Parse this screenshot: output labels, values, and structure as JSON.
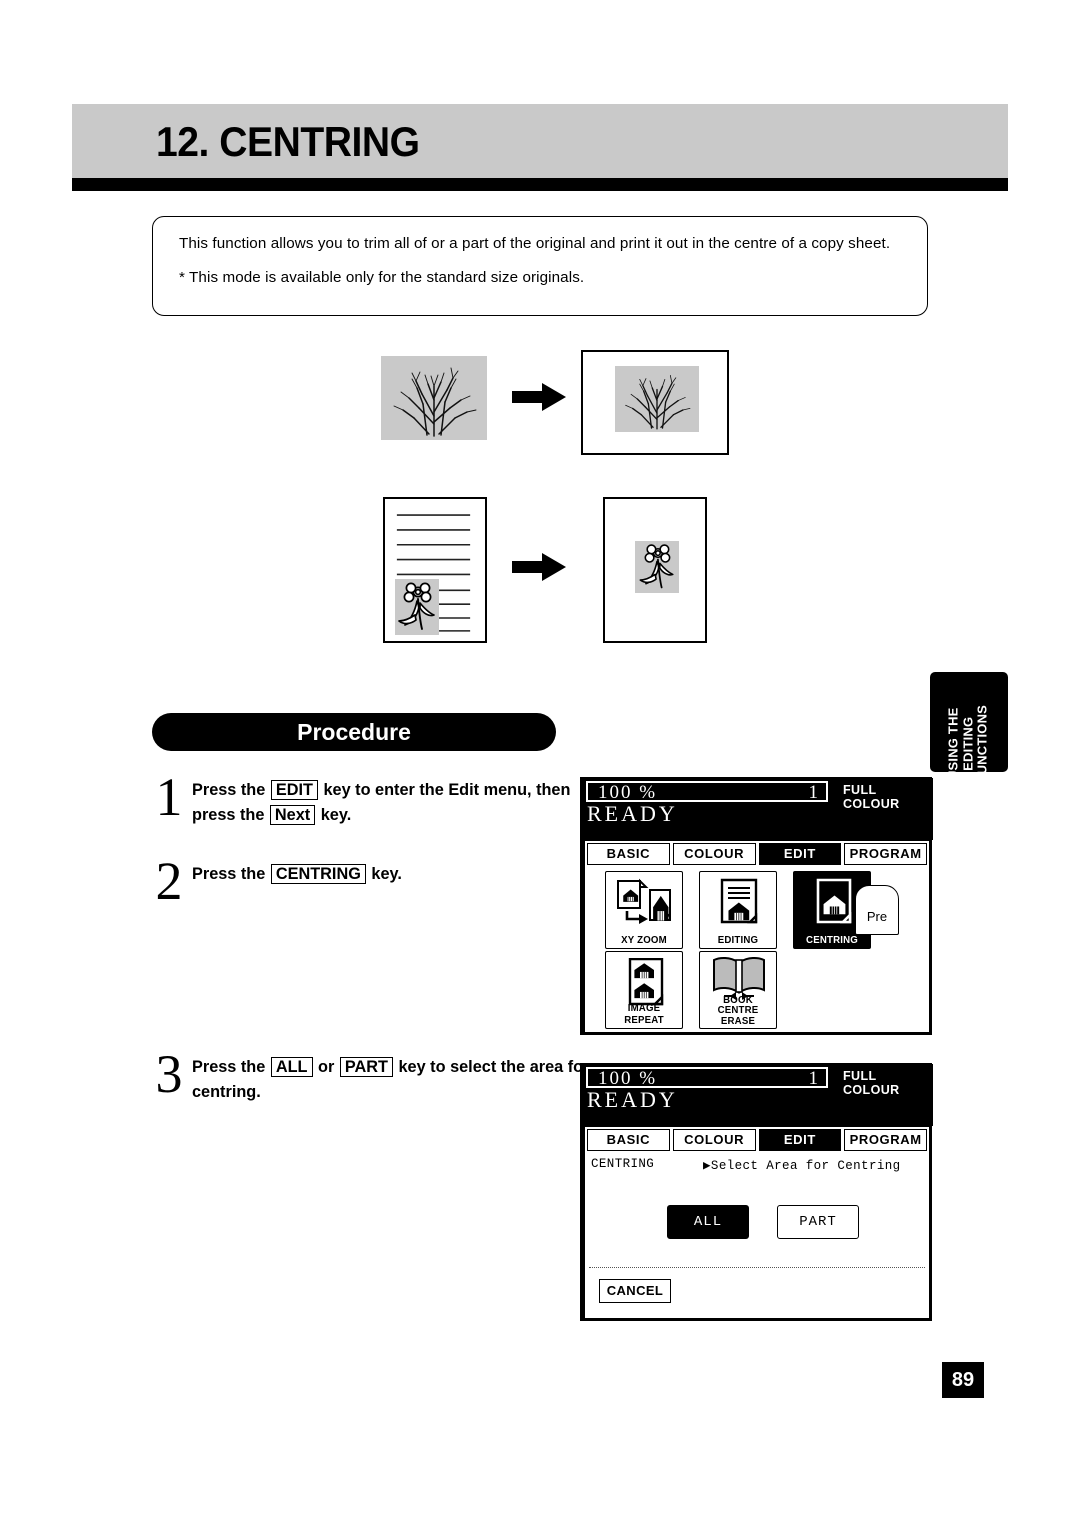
{
  "chapter": {
    "number_title": "12. CENTRING"
  },
  "intro": {
    "paragraph": "This function allows you to trim all of or a part of the original and print it out in the centre of a copy sheet.",
    "note": "* This mode is available only for the standard size originals."
  },
  "side_tab": {
    "label": "USING THE EDITING FUNCTIONS"
  },
  "procedure": {
    "heading": "Procedure",
    "steps": [
      {
        "number": "1",
        "text_parts": [
          "Press the ",
          "EDIT",
          " key to enter the Edit menu, then press the ",
          "Next",
          " key."
        ],
        "keys": [
          "EDIT",
          "Next"
        ]
      },
      {
        "number": "2",
        "text_parts": [
          "Press the ",
          "CENTRING",
          " key."
        ],
        "keys": [
          "CENTRING"
        ]
      },
      {
        "number": "3",
        "text_parts": [
          "Press the ",
          "ALL",
          " or ",
          "PART",
          " key to select the area for centring."
        ],
        "keys": [
          "ALL",
          "PART"
        ]
      }
    ]
  },
  "lcd_panel_1": {
    "status": {
      "zoom": "100 %",
      "copy_count": "1",
      "colour_mode": "FULL COLOUR",
      "message": "READY"
    },
    "tabs": [
      {
        "label": "BASIC",
        "active": false
      },
      {
        "label": "COLOUR",
        "active": false
      },
      {
        "label": "EDIT",
        "active": true
      },
      {
        "label": "PROGRAM",
        "active": false
      }
    ],
    "functions": [
      {
        "label": "XY ZOOM",
        "icon": "xy-zoom-icon",
        "selected": false
      },
      {
        "label": "EDITING",
        "icon": "editing-icon",
        "selected": false
      },
      {
        "label": "CENTRING",
        "icon": "centring-icon",
        "selected": true
      },
      {
        "label": "IMAGE REPEAT",
        "icon": "image-repeat-icon",
        "selected": false
      },
      {
        "label": "BOOK CENTRE ERASE",
        "label_line1": "BOOK CENTRE",
        "label_line2": "ERASE",
        "icon": "book-centre-erase-icon",
        "selected": false
      }
    ],
    "prev_button": {
      "label": "Pre"
    }
  },
  "lcd_panel_2": {
    "status": {
      "zoom": "100 %",
      "copy_count": "1",
      "colour_mode": "FULL COLOUR",
      "message": "READY"
    },
    "tabs": [
      {
        "label": "BASIC",
        "active": false
      },
      {
        "label": "COLOUR",
        "active": false
      },
      {
        "label": "EDIT",
        "active": true
      },
      {
        "label": "PROGRAM",
        "active": false
      }
    ],
    "mode_label": "CENTRING",
    "prompt": "▶Select Area for Centring",
    "choices": [
      {
        "label": "ALL",
        "selected": true
      },
      {
        "label": "PART",
        "selected": false
      }
    ],
    "cancel_label": "CANCEL"
  },
  "page_number": "89",
  "colors": {
    "band": "#c9c9c9",
    "ink": "#000000",
    "paper": "#ffffff"
  }
}
